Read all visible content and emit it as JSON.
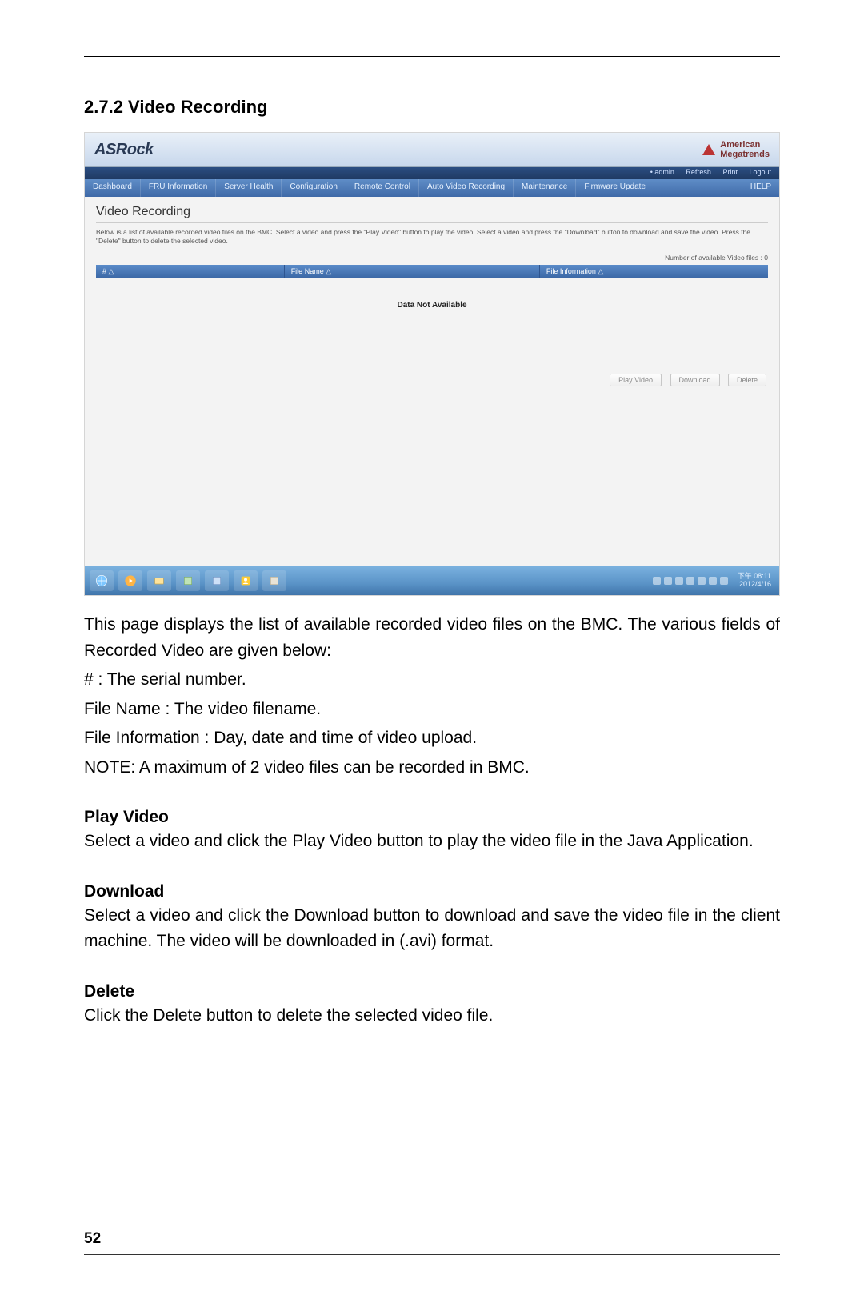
{
  "heading": "2.7.2  Video Recording",
  "screenshot": {
    "brand_left": "ASRock",
    "brand_right_line1": "American",
    "brand_right_line2": "Megatrends",
    "subbar": {
      "user_prefix": "• admin",
      "items": [
        "Refresh",
        "Print",
        "Logout"
      ]
    },
    "nav": [
      "Dashboard",
      "FRU Information",
      "Server Health",
      "Configuration",
      "Remote Control",
      "Auto Video Recording",
      "Maintenance",
      "Firmware Update"
    ],
    "nav_help": "HELP",
    "title": "Video Recording",
    "desc": "Below is a list of available recorded video files on the BMC. Select a video and press the \"Play Video\" button to play the video. Select a video and press the \"Download\" button to download and save the video. Press the \"Delete\" button to delete the selected video.",
    "count_label": "Number of available Video files : 0",
    "columns": {
      "c1": "#  △",
      "c2": "File Name  △",
      "c3": "File Information  △"
    },
    "no_data": "Data Not Available",
    "buttons": {
      "play": "Play Video",
      "download": "Download",
      "delete": "Delete"
    },
    "clock": {
      "t": "下午 08:11",
      "d": "2012/4/16"
    }
  },
  "para1": "This page displays the list of available recorded video files on the BMC. The various fields of Recorded Video are given below:",
  "line_serial": "# : The serial number.",
  "line_filename": "File Name : The video filename.",
  "line_fileinfo": "File Information : Day, date and time of video upload.",
  "line_note": "NOTE: A maximum of 2 video files can be recorded in BMC.",
  "sub_play_h": "Play Video",
  "sub_play_b": "Select a video and click the Play Video button to play the video file in the Java Application.",
  "sub_dl_h": "Download",
  "sub_dl_b": "Select a video and click the Download button to download and save the video file in the client machine. The video will be downloaded in (.avi) format.",
  "sub_del_h": "Delete",
  "sub_del_b": "Click the Delete button to delete the selected video file.",
  "page_number": "52"
}
